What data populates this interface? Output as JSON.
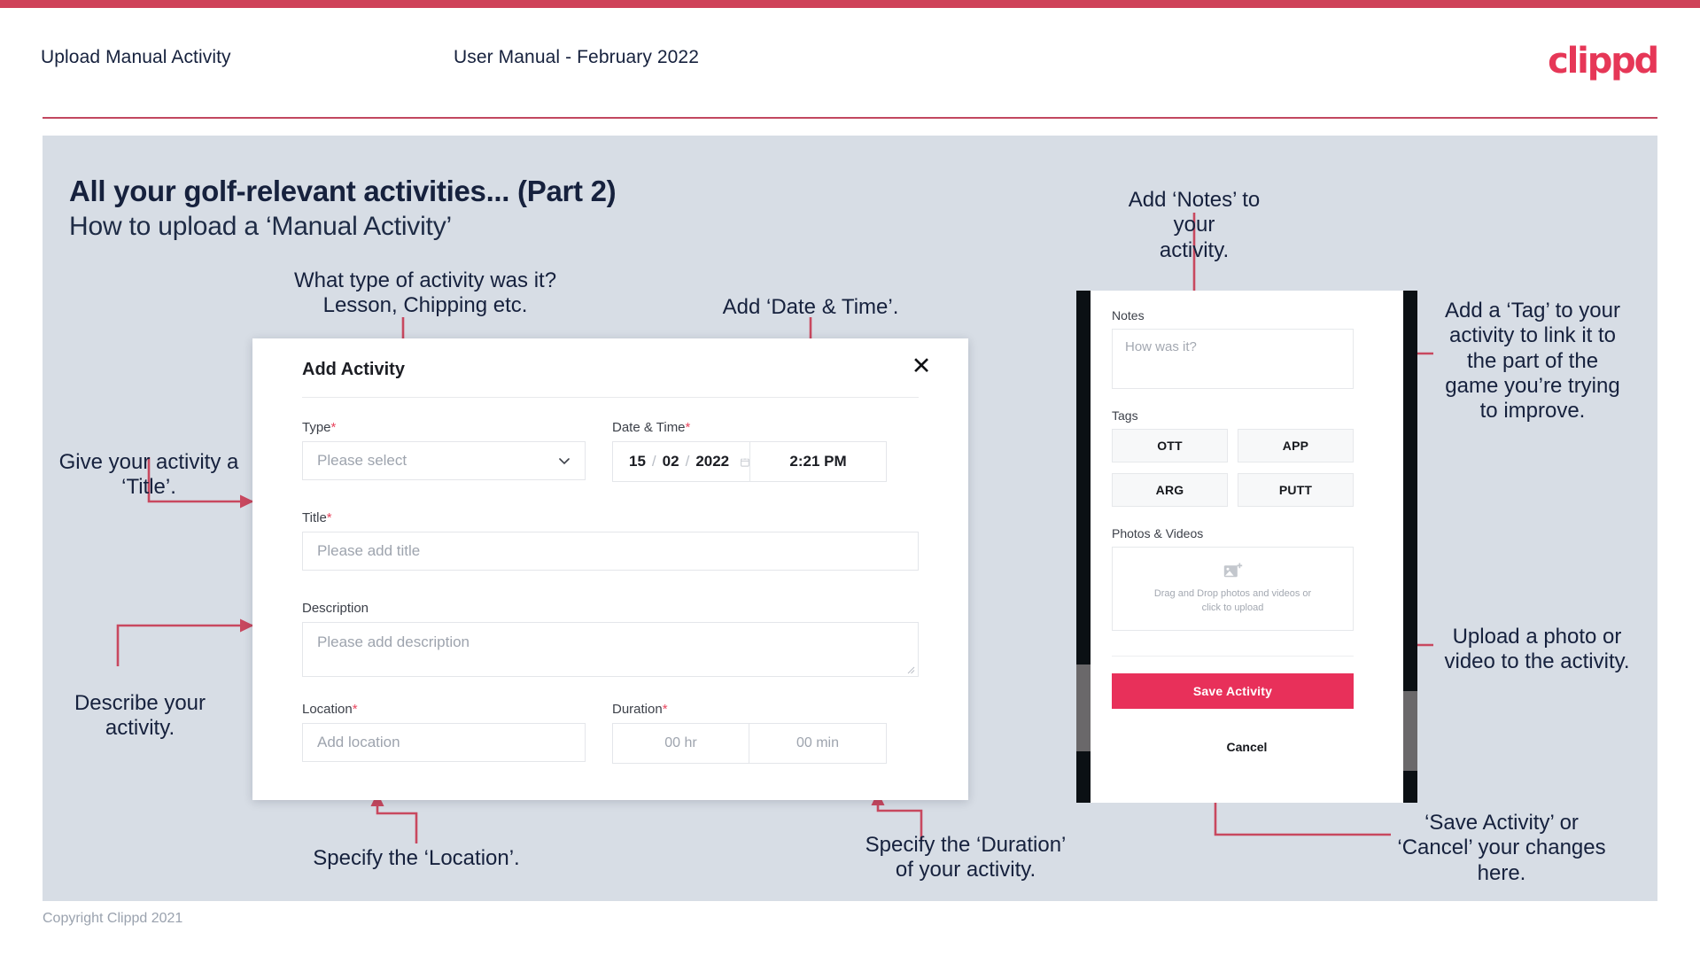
{
  "header": {
    "title": "Upload Manual Activity",
    "subtitle": "User Manual - February 2022",
    "logo": "clippd"
  },
  "slide": {
    "title": "All your golf-relevant activities... (Part 2)",
    "subtitle": "How to upload a ‘Manual Activity’",
    "footer": "Copyright Clippd 2021"
  },
  "annotations": {
    "type": "What type of activity was it?\nLesson, Chipping etc.",
    "datetime": "Add ‘Date & Time’.",
    "notes": "Add ‘Notes’ to your\nactivity.",
    "tag": "Add a ‘Tag’ to your\nactivity to link it to\nthe part of the\ngame you’re trying\nto improve.",
    "title": "Give your activity a\n‘Title’.",
    "describe": "Describe your\nactivity.",
    "location": "Specify the ‘Location’.",
    "duration": "Specify the ‘Duration’\nof your activity.",
    "upload": "Upload a photo or\nvideo to the activity.",
    "save": "‘Save Activity’ or\n‘Cancel’ your changes\nhere."
  },
  "dialog": {
    "title": "Add Activity",
    "close_icon": "close-icon",
    "fields": {
      "type": {
        "label": "Type",
        "required": true,
        "placeholder": "Please select"
      },
      "datetime": {
        "label": "Date & Time",
        "required": true,
        "day": "15",
        "month": "02",
        "year": "2022",
        "time": "2:21 PM"
      },
      "title": {
        "label": "Title",
        "required": true,
        "placeholder": "Please add title"
      },
      "description": {
        "label": "Description",
        "required": false,
        "placeholder": "Please add description"
      },
      "location": {
        "label": "Location",
        "required": true,
        "placeholder": "Add location"
      },
      "duration": {
        "label": "Duration",
        "required": true,
        "hours": "00 hr",
        "minutes": "00 min"
      }
    },
    "required_marker": "*",
    "date_separator": "/"
  },
  "phone": {
    "notes": {
      "label": "Notes",
      "placeholder": "How was it?"
    },
    "tags": {
      "label": "Tags",
      "items": [
        "OTT",
        "APP",
        "ARG",
        "PUTT"
      ]
    },
    "photos": {
      "label": "Photos & Videos",
      "dropzone_text": "Drag and Drop photos and videos or\nclick to upload"
    },
    "save_label": "Save Activity",
    "cancel_label": "Cancel"
  },
  "colors": {
    "brand": "#e63757",
    "accent_bar": "#cf4259",
    "slide_bg": "#d7dde5",
    "ink": "#16213d",
    "save_button": "#e8305a",
    "connector": "#c8485f"
  }
}
